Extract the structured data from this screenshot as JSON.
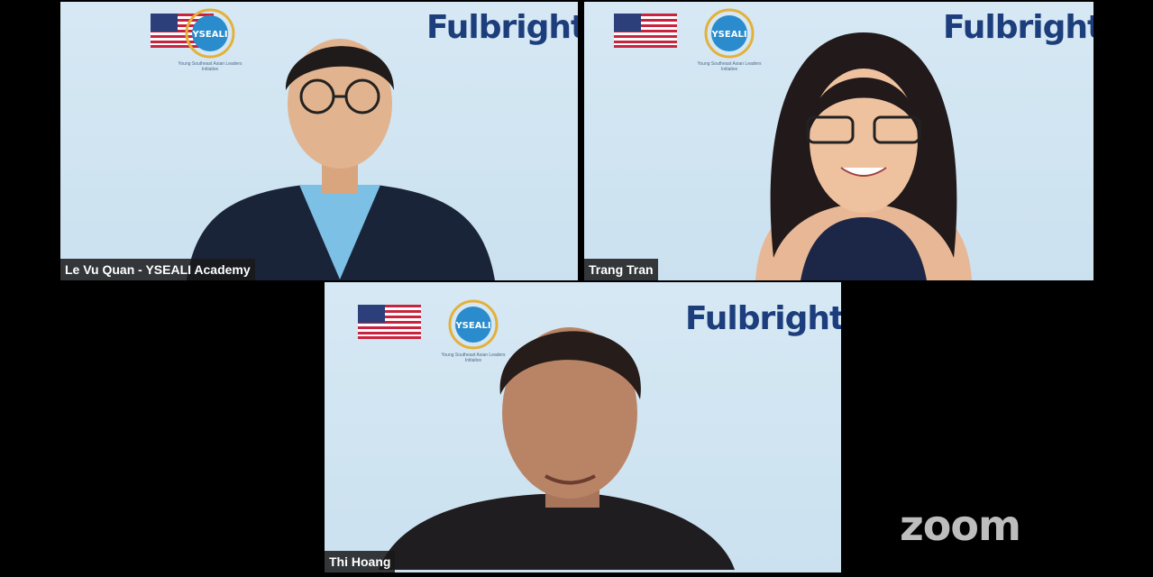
{
  "participants": [
    {
      "name": "Le Vu Quan - YSEALI Academy",
      "active": false
    },
    {
      "name": "Trang Tran",
      "active": false
    },
    {
      "name": "Thi Hoang",
      "active": true
    }
  ],
  "background": {
    "brand": "Fulbright",
    "logo_text": "YSEALI",
    "logo_subtext": "Young Southeast Asian Leaders Initiative"
  },
  "watermark": "zoom",
  "colors": {
    "active_border": "#7ee05b",
    "brand": "#1d3e7c",
    "backdrop": "#cfe4f1"
  }
}
